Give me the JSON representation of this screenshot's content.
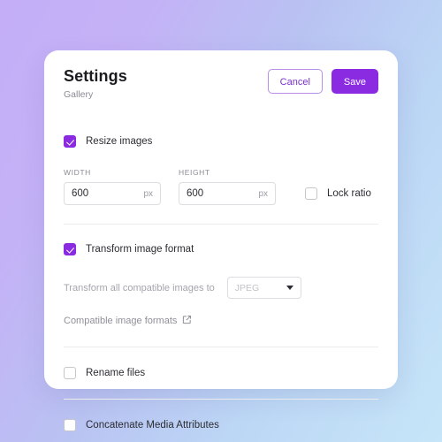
{
  "header": {
    "title": "Settings",
    "subtitle": "Gallery",
    "cancel_label": "Cancel",
    "save_label": "Save"
  },
  "theme": {
    "accent": "#8a2be2",
    "cancel_text": "#7b2fd0",
    "divider": "#ececed",
    "bg_left": "#c3aef7",
    "bg_right": "#c6e5f8"
  },
  "resize": {
    "label": "Resize images",
    "checked": true,
    "width": {
      "label": "WIDTH",
      "value": "600",
      "suffix": "px"
    },
    "height": {
      "label": "HEIGHT",
      "value": "600",
      "suffix": "px"
    },
    "lock_ratio": {
      "label": "Lock ratio",
      "checked": false
    }
  },
  "transform": {
    "label": "Transform image format",
    "checked": true,
    "caption": "Transform all compatible images to",
    "format_value": "JPEG",
    "format_options": [
      "JPEG"
    ],
    "link_label": "Compatible image formats",
    "link_icon": "external-link-icon"
  },
  "rename": {
    "label": "Rename files",
    "checked": false
  },
  "concatenate": {
    "label": "Concatenate Media Attributes",
    "checked": false
  }
}
